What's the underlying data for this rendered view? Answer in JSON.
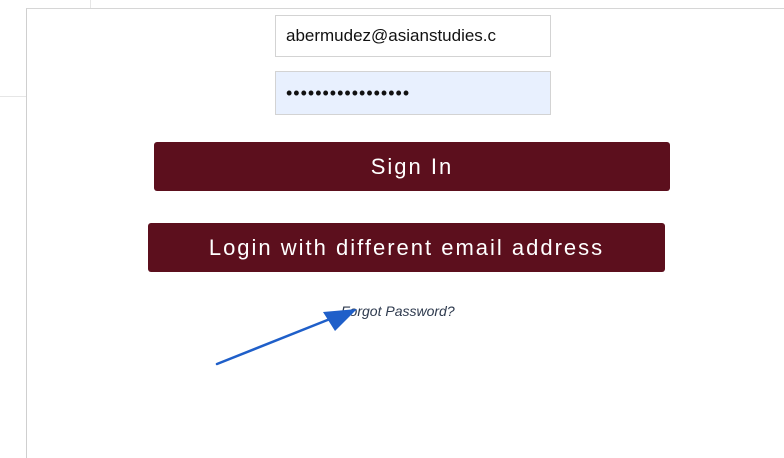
{
  "login_form": {
    "email_value": "abermudez@asianstudies.c",
    "password_value": "•••••••••••••••••",
    "sign_in_label": "Sign In",
    "alt_login_label": "Login with different email address",
    "forgot_password_label": "Forgot Password?"
  },
  "annotation": {
    "arrow_icon": "arrow-pointer-icon",
    "arrow_color": "#1f5fc9"
  },
  "colors": {
    "button_bg": "#5c0f1d",
    "password_autofill_bg": "#e8f0fe"
  }
}
